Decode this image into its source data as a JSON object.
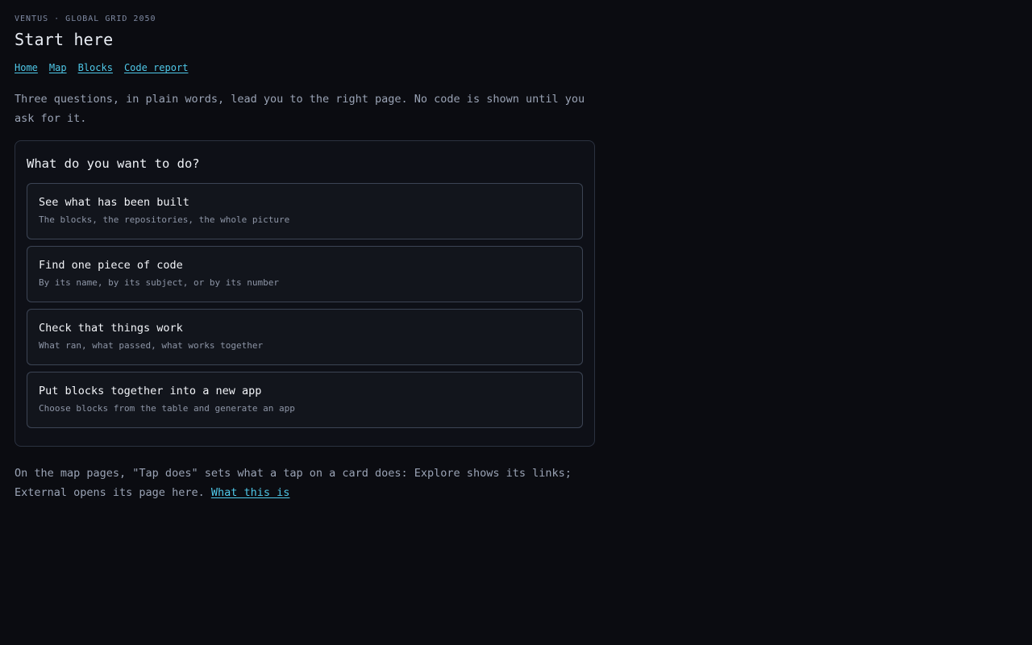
{
  "header": {
    "eyebrow": "VENTUS · GLOBAL GRID 2050",
    "title": "Start here"
  },
  "nav": {
    "items": [
      {
        "label": "Home"
      },
      {
        "label": "Map"
      },
      {
        "label": "Blocks"
      },
      {
        "label": "Code report"
      }
    ]
  },
  "intro": {
    "text": "Three questions, in plain words, lead you to the right page. No code is shown until you ask for it."
  },
  "panel": {
    "title": "What do you want to do?",
    "options": [
      {
        "title": "See what has been built",
        "desc": "The blocks, the repositories, the whole picture"
      },
      {
        "title": "Find one piece of code",
        "desc": "By its name, by its subject, or by its number"
      },
      {
        "title": "Check that things work",
        "desc": "What ran, what passed, what works together"
      },
      {
        "title": "Put blocks together into a new app",
        "desc": "Choose blocks from the table and generate an app"
      }
    ]
  },
  "footer": {
    "text": "On the map pages, \"Tap does\" sets what a tap on a card does: Explore shows its links; External opens its page here. ",
    "link_label": "What this is"
  },
  "colors": {
    "background": "#0b0c11",
    "link": "#4fc8e8",
    "muted_text": "#9aa3b5"
  }
}
